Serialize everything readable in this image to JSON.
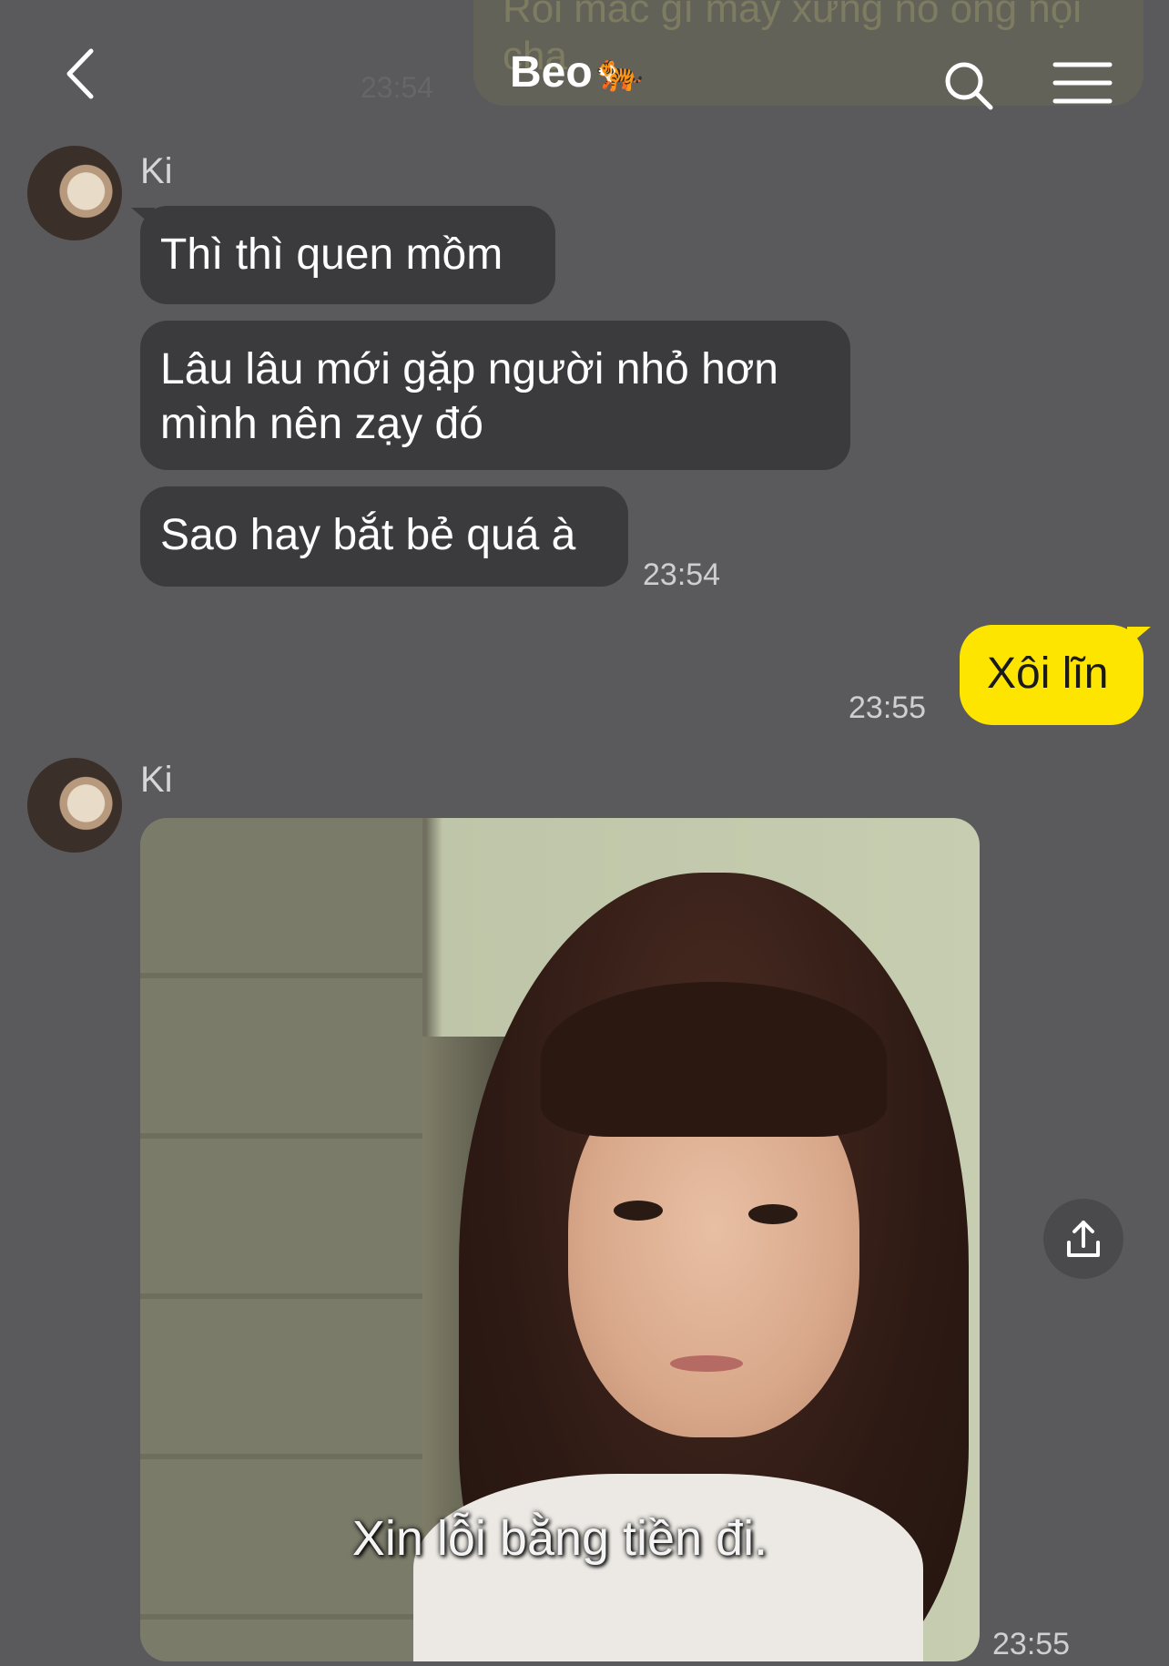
{
  "header": {
    "title": "Beo",
    "title_emoji": "🐅",
    "back_icon": "chevron-left-icon",
    "search_icon": "search-icon",
    "menu_icon": "menu-icon"
  },
  "previous_message": {
    "text": "Rồi mắc gì mày xưng nó ông nội cha",
    "time": "23:54"
  },
  "messages": [
    {
      "sender": "Ki",
      "bubbles": [
        "Thì thì quen mồm",
        "Lâu lâu mới gặp người nhỏ hơn mình nên zạy đó",
        "Sao hay bắt bẻ quá à"
      ],
      "time": "23:54"
    },
    {
      "mine": true,
      "text": "Xôi lĩn",
      "time": "23:55"
    },
    {
      "sender": "Ki",
      "photo_caption": "Xin lỗi bằng tiền đi.",
      "time": "23:55"
    }
  ],
  "colors": {
    "background": "#5a5a5c",
    "incoming_bubble": "#3b3b3d",
    "outgoing_bubble": "#fee500"
  }
}
